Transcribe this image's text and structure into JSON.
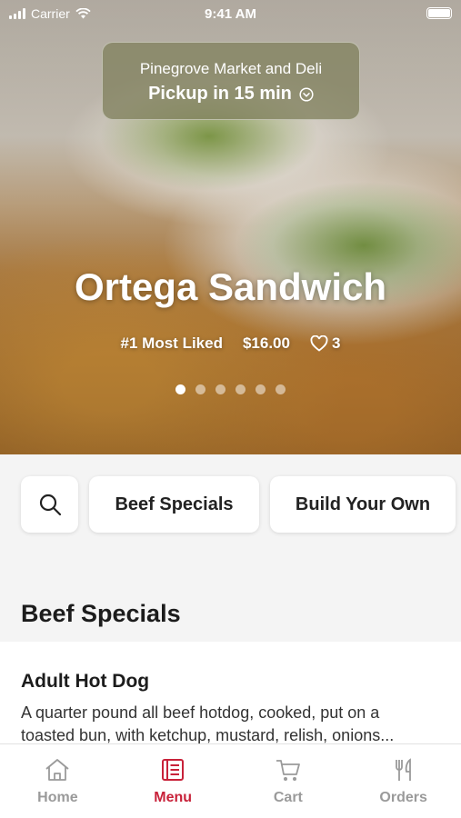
{
  "status_bar": {
    "carrier": "Carrier",
    "time": "9:41 AM"
  },
  "pickup": {
    "store": "Pinegrove Market and Deli",
    "time": "Pickup in 15 min"
  },
  "hero": {
    "title": "Ortega Sandwich",
    "tag": "#1 Most Liked",
    "price": "$16.00",
    "likes": "3",
    "carousel": {
      "count": 6,
      "active": 1
    }
  },
  "filters": [
    {
      "label": "",
      "icon": "search-icon"
    },
    {
      "label": "Beef Specials"
    },
    {
      "label": "Build Your Own"
    }
  ],
  "section": {
    "title": "Beef Specials"
  },
  "items": [
    {
      "name": "Adult Hot Dog",
      "desc_line1": "A quarter pound all beef hotdog, cooked, put on a",
      "desc_line2": "toasted bun, with ketchup, mustard, relish, onions..."
    }
  ],
  "tabs": [
    {
      "label": "Home",
      "icon": "home-icon"
    },
    {
      "label": "Menu",
      "icon": "menu-icon",
      "active": true
    },
    {
      "label": "Cart",
      "icon": "cart-icon"
    },
    {
      "label": "Orders",
      "icon": "utensils-icon"
    }
  ],
  "colors": {
    "accent": "#c8223a",
    "inactive_tab": "#9a9a9a"
  }
}
